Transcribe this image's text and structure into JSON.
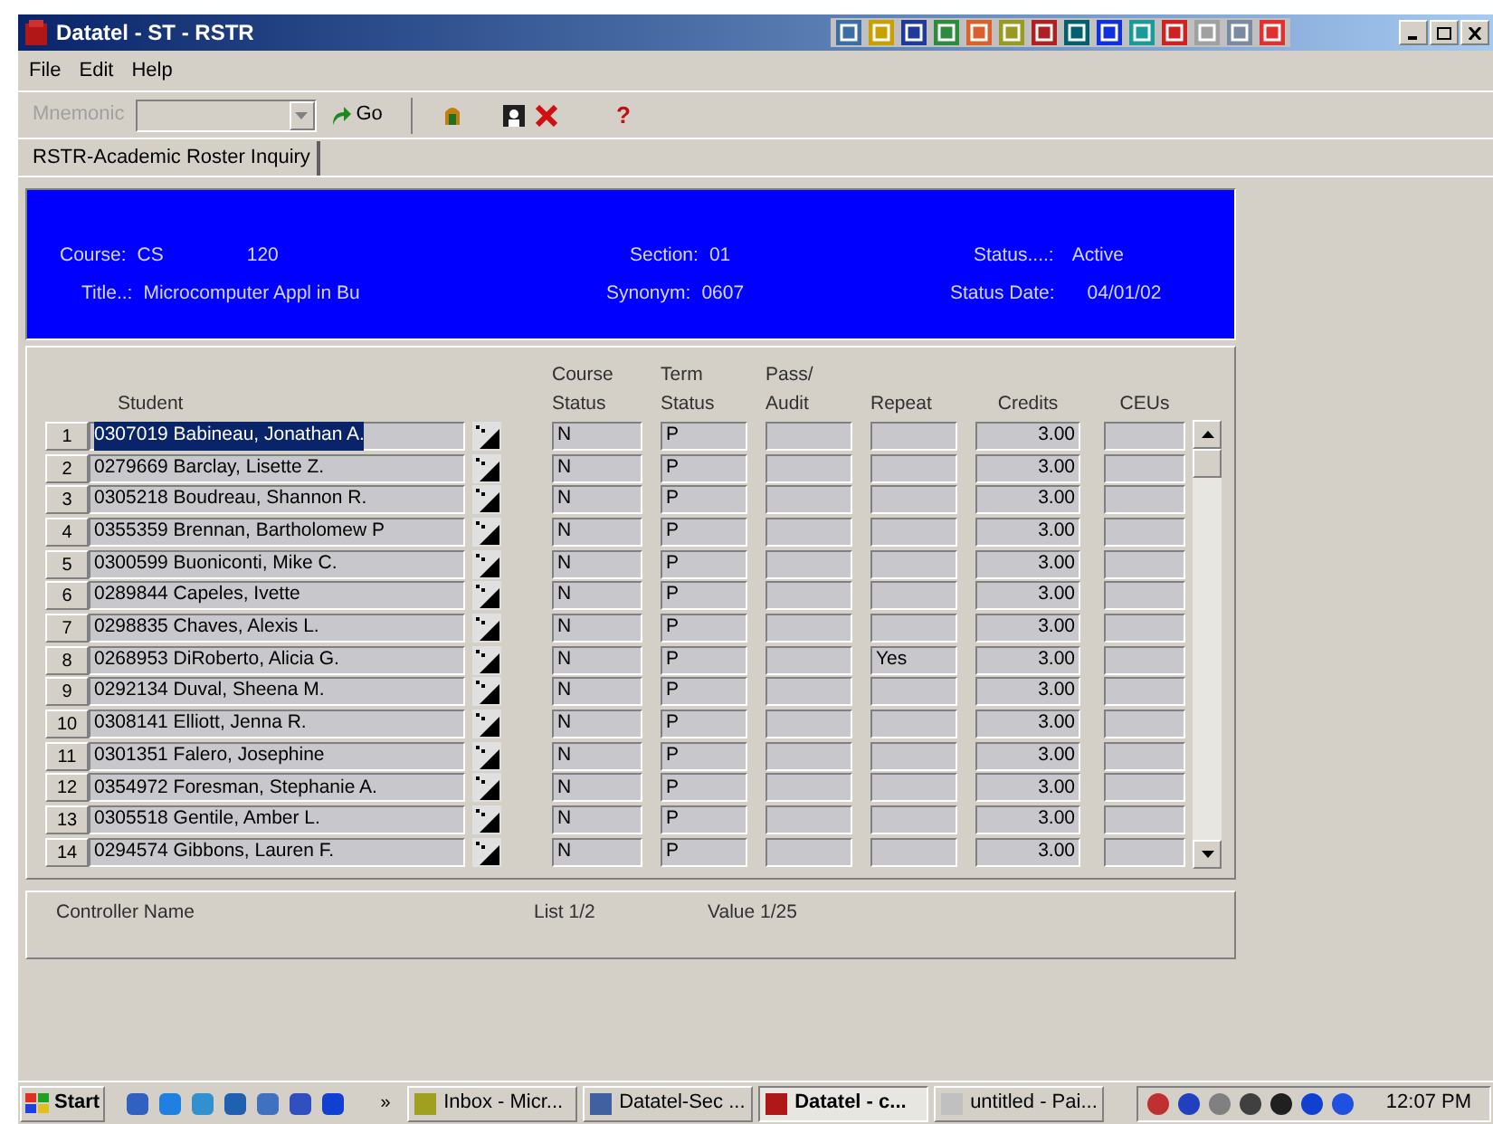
{
  "window": {
    "title": "Datatel - ST - RSTR"
  },
  "menu": [
    "File",
    "Edit",
    "Help"
  ],
  "toolbar": {
    "mnemonic_label": "Mnemonic",
    "go": "Go",
    "help": "?"
  },
  "tab": {
    "label": "RSTR-Academic Roster Inquiry",
    "selected": true
  },
  "header": {
    "fields": [
      {
        "label": "Course:",
        "value": "CS",
        "value_2": "120"
      },
      {
        "label": "Section:",
        "value": "01"
      },
      {
        "label": "Status....:",
        "value": "Active"
      },
      {
        "label": "Title..:",
        "value": "Microcomputer Appl in Bu"
      },
      {
        "label": "Synonym:",
        "value": "0607"
      },
      {
        "label": "Status Date:",
        "value": "04/01/02"
      }
    ]
  },
  "table": {
    "columns": [
      {
        "line2": "Student"
      },
      {
        "line1": "Course",
        "line2": "Status"
      },
      {
        "line1": "Term",
        "line2": "Status"
      },
      {
        "line1": "Pass/",
        "line2": "Audit"
      },
      {
        "line2": "Repeat"
      },
      {
        "line2": "Credits"
      },
      {
        "line2": "CEUs"
      }
    ],
    "rows": [
      {
        "num": "1",
        "student": "0307019 Babineau, Jonathan A.",
        "course_status": "N",
        "term_status": "P",
        "credits": "3.00",
        "selected": true
      },
      {
        "num": "2",
        "student": "0279669 Barclay, Lisette Z.",
        "course_status": "N",
        "term_status": "P",
        "credits": "3.00",
        "selected": false
      },
      {
        "num": "3",
        "student": "0305218 Boudreau, Shannon R.",
        "course_status": "N",
        "term_status": "P",
        "credits": "3.00",
        "selected": false
      },
      {
        "num": "4",
        "student": "0355359 Brennan, Bartholomew P",
        "course_status": "N",
        "term_status": "P",
        "credits": "3.00",
        "selected": false
      },
      {
        "num": "5",
        "student": "0300599 Buoniconti, Mike C.",
        "course_status": "N",
        "term_status": "P",
        "credits": "3.00",
        "selected": false
      },
      {
        "num": "6",
        "student": "0289844 Capeles, Ivette",
        "course_status": "N",
        "term_status": "P",
        "credits": "3.00",
        "selected": false
      },
      {
        "num": "7",
        "student": "0298835 Chaves, Alexis L.",
        "course_status": "N",
        "term_status": "P",
        "credits": "3.00",
        "selected": false
      },
      {
        "num": "8",
        "student": "0268953 DiRoberto, Alicia G.",
        "course_status": "N",
        "term_status": "P",
        "repeat": "Yes",
        "credits": "3.00",
        "selected": false
      },
      {
        "num": "9",
        "student": "0292134 Duval, Sheena M.",
        "course_status": "N",
        "term_status": "P",
        "credits": "3.00",
        "selected": false
      },
      {
        "num": "10",
        "student": "0308141 Elliott, Jenna R.",
        "course_status": "N",
        "term_status": "P",
        "credits": "3.00",
        "selected": false
      },
      {
        "num": "11",
        "student": "0301351 Falero, Josephine",
        "course_status": "N",
        "term_status": "P",
        "credits": "3.00",
        "selected": false
      },
      {
        "num": "12",
        "student": "0354972 Foresman, Stephanie A.",
        "course_status": "N",
        "term_status": "P",
        "credits": "3.00",
        "selected": false
      },
      {
        "num": "13",
        "student": "0305518 Gentile, Amber L.",
        "course_status": "N",
        "term_status": "P",
        "credits": "3.00",
        "selected": false
      },
      {
        "num": "14",
        "student": "0294574 Gibbons, Lauren F.",
        "course_status": "N",
        "term_status": "P",
        "credits": "3.00",
        "selected": false
      }
    ]
  },
  "status_bar": {
    "controller": "Controller Name",
    "list": "List 1/2",
    "value": "Value 1/25"
  },
  "taskbar": {
    "start": "Start",
    "more": "»",
    "tasks": [
      {
        "label": "Inbox - Micr...",
        "selected": false
      },
      {
        "label": "Datatel-Sec ...",
        "selected": false
      },
      {
        "label": "Datatel - c...",
        "selected": true
      },
      {
        "label": "untitled - Pai...",
        "selected": false
      }
    ],
    "clock": "12:07 PM"
  }
}
